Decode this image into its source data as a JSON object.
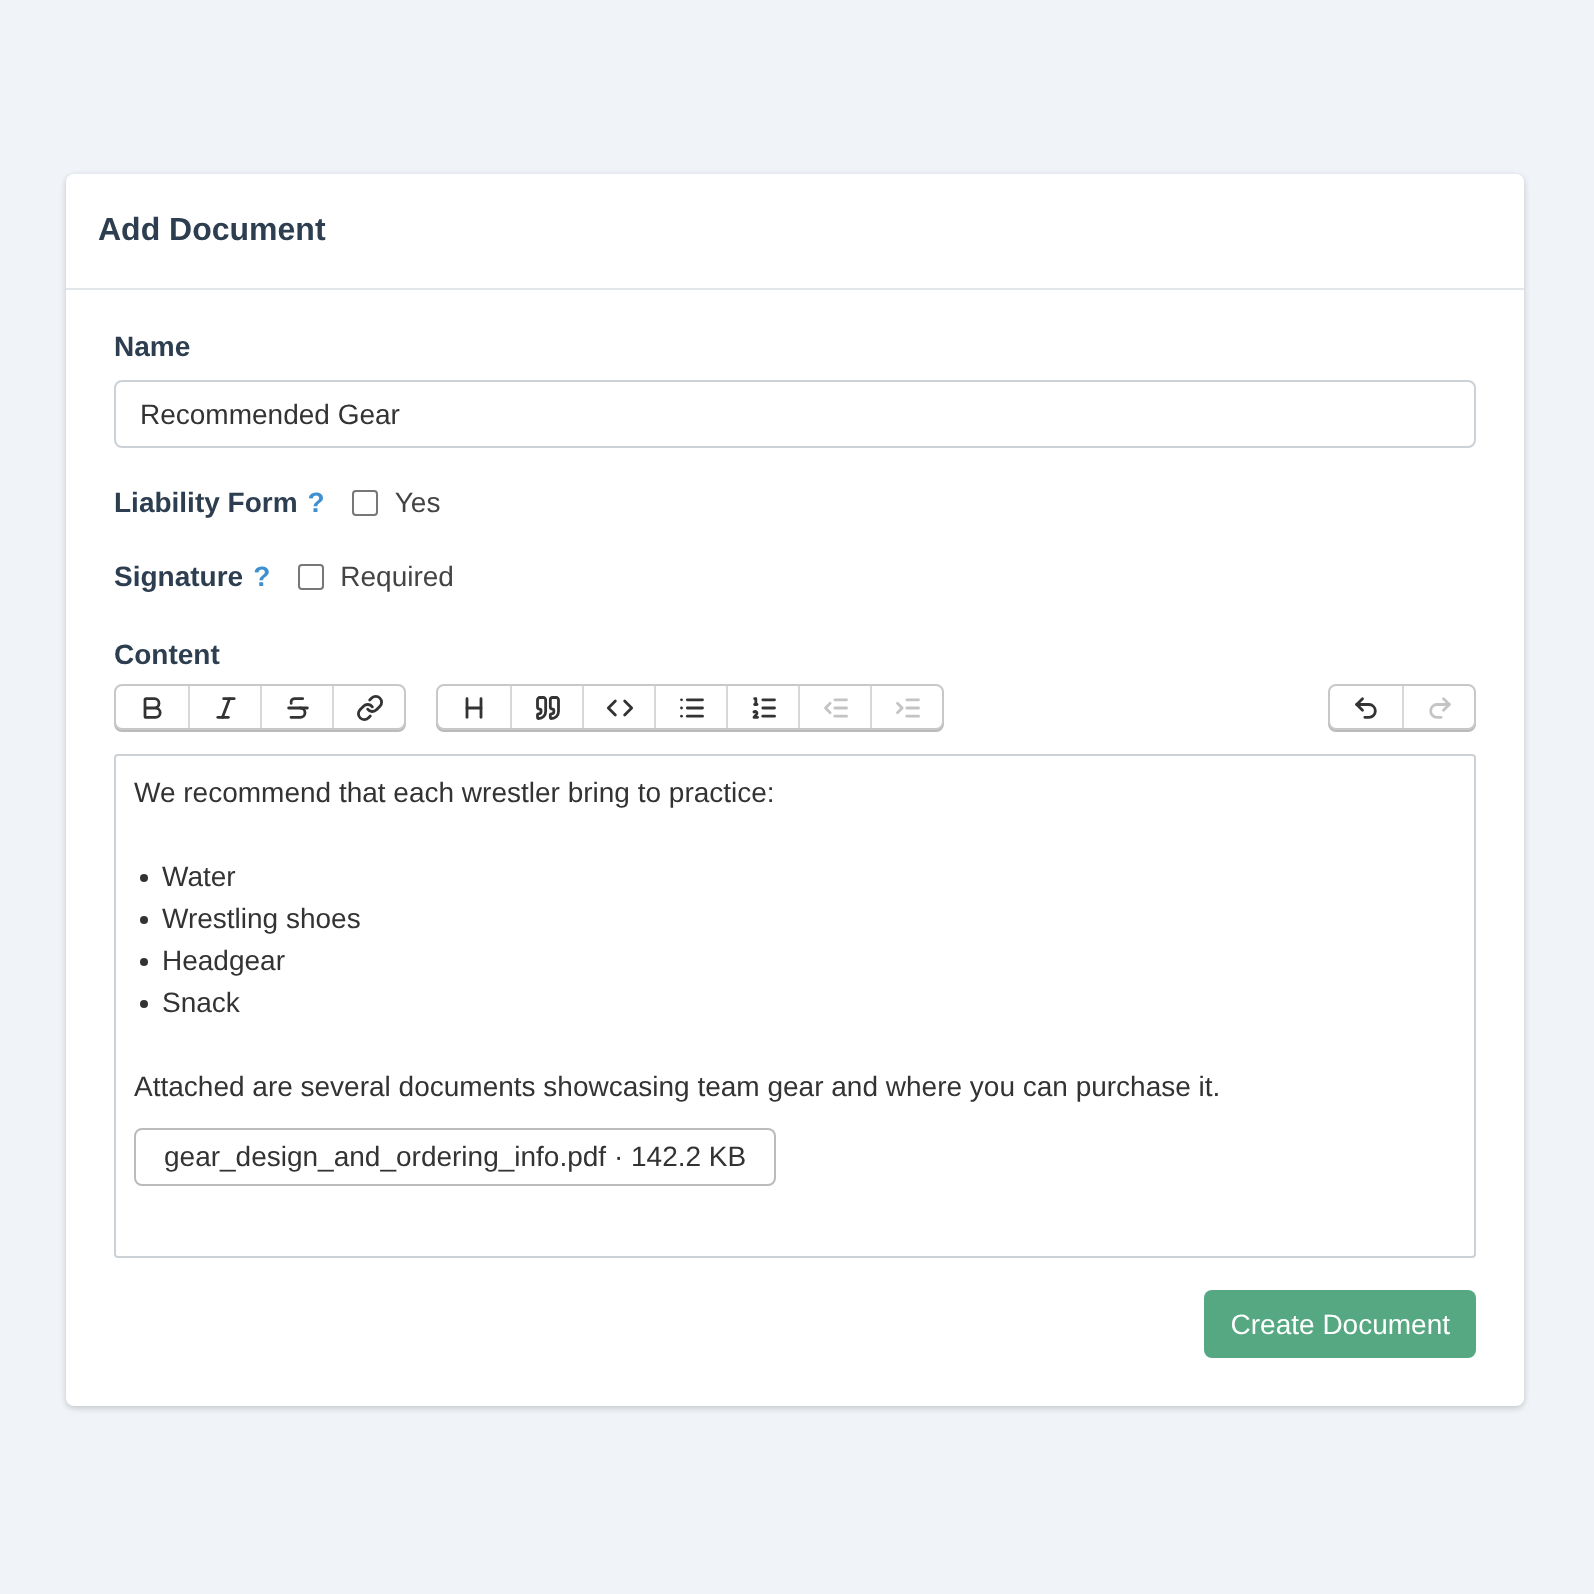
{
  "card": {
    "title": "Add Document"
  },
  "name_field": {
    "label": "Name",
    "value": "Recommended Gear"
  },
  "options": [
    {
      "label": "Liability Form",
      "help": "?",
      "checkbox_label": "Yes",
      "checked": false
    },
    {
      "label": "Signature",
      "help": "?",
      "checkbox_label": "Required",
      "checked": false
    }
  ],
  "content": {
    "label": "Content",
    "toolbar": [
      [
        {
          "kind": "bold",
          "disabled": false
        },
        {
          "kind": "italic",
          "disabled": false
        },
        {
          "kind": "strike",
          "disabled": false
        },
        {
          "kind": "link",
          "disabled": false
        }
      ],
      [
        {
          "kind": "heading",
          "disabled": false
        },
        {
          "kind": "quote",
          "disabled": false
        },
        {
          "kind": "code",
          "disabled": false
        },
        {
          "kind": "bullets",
          "disabled": false
        },
        {
          "kind": "numbers",
          "disabled": false
        },
        {
          "kind": "outdent",
          "disabled": true
        },
        {
          "kind": "indent",
          "disabled": true
        }
      ],
      [
        {
          "kind": "undo",
          "disabled": false
        },
        {
          "kind": "redo",
          "disabled": true
        }
      ]
    ],
    "intro": "We recommend that each wrestler bring to practice:",
    "items": [
      "Water",
      "Wrestling shoes",
      "Headgear",
      "Snack"
    ],
    "outro": "Attached are several documents showcasing team gear and where you can purchase it.",
    "attachment": "gear_design_and_ordering_info.pdf · 142.2 KB"
  },
  "submit": "Create Document"
}
